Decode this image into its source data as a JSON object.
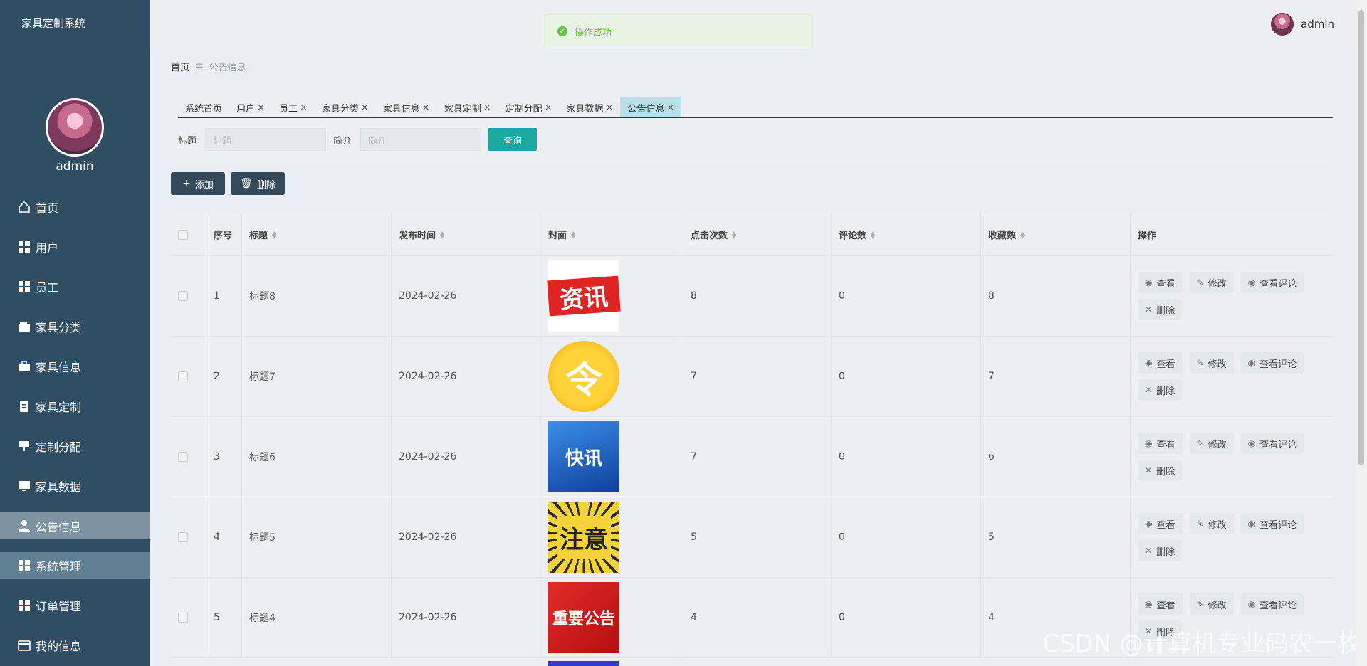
{
  "app": {
    "title": "家具定制系统",
    "username": "admin"
  },
  "toast": {
    "message": "操作成功"
  },
  "menu": [
    {
      "label": "首页",
      "icon": "home-icon"
    },
    {
      "label": "用户",
      "icon": "grid-icon"
    },
    {
      "label": "员工",
      "icon": "grid-icon"
    },
    {
      "label": "家具分类",
      "icon": "wallet-icon"
    },
    {
      "label": "家具信息",
      "icon": "briefcase-icon"
    },
    {
      "label": "家具定制",
      "icon": "clipboard-icon"
    },
    {
      "label": "定制分配",
      "icon": "filter-icon"
    },
    {
      "label": "家具数据",
      "icon": "monitor-icon"
    },
    {
      "label": "公告信息",
      "icon": "user-icon"
    },
    {
      "label": "系统管理",
      "icon": "grid-icon"
    },
    {
      "label": "订单管理",
      "icon": "grid-icon"
    },
    {
      "label": "我的信息",
      "icon": "card-icon"
    }
  ],
  "breadcrumb": {
    "home": "首页",
    "sep": "☰",
    "current": "公告信息"
  },
  "tabs": [
    "系统首页",
    "用户",
    "员工",
    "家具分类",
    "家具信息",
    "家具定制",
    "定制分配",
    "家具数据",
    "公告信息"
  ],
  "search": {
    "title_label": "标题",
    "title_placeholder": "标题",
    "summary_label": "简介",
    "summary_placeholder": "简介",
    "query_button": "查询"
  },
  "actions": {
    "add": "添加",
    "delete": "删除"
  },
  "table": {
    "headers": [
      "序号",
      "标题",
      "发布时间",
      "封面",
      "点击次数",
      "评论数",
      "收藏数",
      "操作"
    ],
    "ops": {
      "view": "查看",
      "edit": "修改",
      "comments": "查看评论",
      "delete": "删除"
    },
    "rows": [
      {
        "no": "1",
        "title": "标题8",
        "date": "2024-02-26",
        "cover": "资讯",
        "clicks": "8",
        "comments": "0",
        "favorites": "8"
      },
      {
        "no": "2",
        "title": "标题7",
        "date": "2024-02-26",
        "cover": "令",
        "clicks": "7",
        "comments": "0",
        "favorites": "7"
      },
      {
        "no": "3",
        "title": "标题6",
        "date": "2024-02-26",
        "cover": "快讯",
        "clicks": "7",
        "comments": "0",
        "favorites": "6"
      },
      {
        "no": "4",
        "title": "标题5",
        "date": "2024-02-26",
        "cover": "注意",
        "clicks": "5",
        "comments": "0",
        "favorites": "5"
      },
      {
        "no": "5",
        "title": "标题4",
        "date": "2024-02-26",
        "cover": "重要公告",
        "clicks": "4",
        "comments": "0",
        "favorites": "4"
      }
    ]
  },
  "watermark": "CSDN @计算机专业码农一枚"
}
